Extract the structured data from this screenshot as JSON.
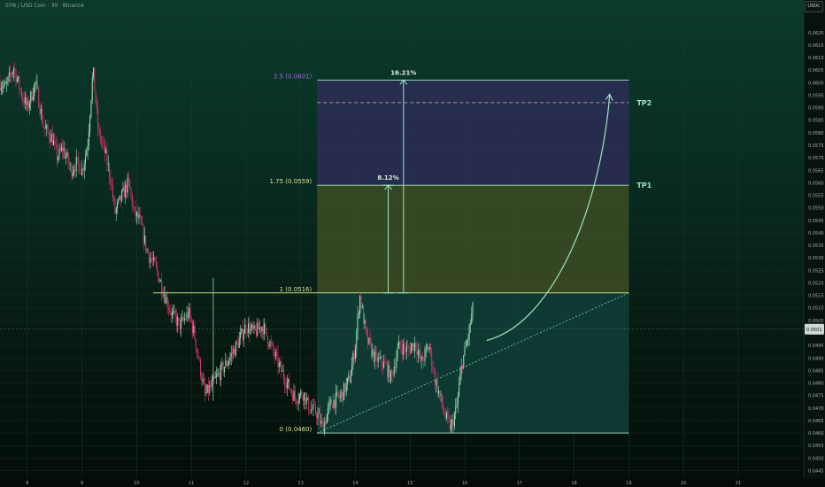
{
  "header": {
    "title": "SYN / USD Coin · 30 · Binance",
    "currency": "USDC"
  },
  "colors": {
    "up": "#9fe6b8",
    "down": "#d6336c",
    "level_line": "#9fe6c2",
    "zone_top": "#2a2c52",
    "zone_mid": "#3a4a23",
    "zone_bottom": "#0f3d36",
    "tp_label": "#9fe6c2",
    "price_tag": "#cfd8d3"
  },
  "chart_data": {
    "type": "candlestick",
    "symbol": "SYN / USD Coin",
    "interval": "30",
    "exchange": "Binance",
    "x_axis": {
      "unit": "day",
      "range": [
        7.5,
        22.2
      ],
      "ticks": [
        "8",
        "9",
        "10",
        "11",
        "12",
        "13",
        "14",
        "15",
        "16",
        "17",
        "18",
        "19",
        "20",
        "21"
      ]
    },
    "y_axis": {
      "range": [
        0.0442,
        0.0633
      ],
      "ticks": [
        "0.0445",
        "0.0450",
        "0.0455",
        "0.0460",
        "0.0465",
        "0.0470",
        "0.0475",
        "0.0480",
        "0.0485",
        "0.0490",
        "0.0495",
        "0.0500",
        "0.0505",
        "0.0510",
        "0.0515",
        "0.0520",
        "0.0525",
        "0.0530",
        "0.0535",
        "0.0540",
        "0.0545",
        "0.0550",
        "0.0555",
        "0.0560",
        "0.0565",
        "0.0570",
        "0.0575",
        "0.0580",
        "0.0585",
        "0.0590",
        "0.0595",
        "0.0600",
        "0.0605",
        "0.0610",
        "0.0615",
        "0.0620"
      ]
    },
    "current_price": {
      "label": "0.0501",
      "value": 0.05015
    },
    "price_path": [
      [
        7.5,
        0.06
      ],
      [
        7.6,
        0.0598
      ],
      [
        7.75,
        0.0606
      ],
      [
        7.9,
        0.0595
      ],
      [
        8.0,
        0.059
      ],
      [
        8.15,
        0.06
      ],
      [
        8.3,
        0.0582
      ],
      [
        8.45,
        0.0578
      ],
      [
        8.55,
        0.057
      ],
      [
        8.65,
        0.0574
      ],
      [
        8.8,
        0.0565
      ],
      [
        8.9,
        0.0568
      ],
      [
        9.0,
        0.0565
      ],
      [
        9.1,
        0.0575
      ],
      [
        9.2,
        0.0605
      ],
      [
        9.3,
        0.058
      ],
      [
        9.42,
        0.0572
      ],
      [
        9.52,
        0.0562
      ],
      [
        9.6,
        0.0548
      ],
      [
        9.72,
        0.0554
      ],
      [
        9.85,
        0.056
      ],
      [
        9.95,
        0.0548
      ],
      [
        10.05,
        0.0545
      ],
      [
        10.2,
        0.0532
      ],
      [
        10.35,
        0.0526
      ],
      [
        10.5,
        0.0516
      ],
      [
        10.65,
        0.0507
      ],
      [
        10.8,
        0.0503
      ],
      [
        10.95,
        0.0508
      ],
      [
        11.05,
        0.05
      ],
      [
        11.15,
        0.0487
      ],
      [
        11.25,
        0.0475
      ],
      [
        11.4,
        0.048
      ],
      [
        11.55,
        0.0485
      ],
      [
        11.7,
        0.049
      ],
      [
        11.85,
        0.0496
      ],
      [
        12.0,
        0.0503
      ],
      [
        12.15,
        0.05
      ],
      [
        12.3,
        0.0503
      ],
      [
        12.45,
        0.0495
      ],
      [
        12.6,
        0.0487
      ],
      [
        12.75,
        0.048
      ],
      [
        12.9,
        0.0474
      ],
      [
        13.05,
        0.0476
      ],
      [
        13.15,
        0.047
      ],
      [
        13.3,
        0.0468
      ],
      [
        13.4,
        0.0462
      ],
      [
        13.55,
        0.0472
      ],
      [
        13.75,
        0.0475
      ],
      [
        13.9,
        0.0482
      ],
      [
        14.0,
        0.0495
      ],
      [
        14.08,
        0.0515
      ],
      [
        14.2,
        0.0498
      ],
      [
        14.35,
        0.049
      ],
      [
        14.55,
        0.0487
      ],
      [
        14.65,
        0.0482
      ],
      [
        14.8,
        0.0495
      ],
      [
        14.95,
        0.0493
      ],
      [
        15.1,
        0.0496
      ],
      [
        15.2,
        0.0488
      ],
      [
        15.35,
        0.0495
      ],
      [
        15.45,
        0.0482
      ],
      [
        15.55,
        0.0474
      ],
      [
        15.65,
        0.0466
      ],
      [
        15.75,
        0.0462
      ],
      [
        15.85,
        0.047
      ],
      [
        15.95,
        0.0488
      ],
      [
        16.05,
        0.0497
      ],
      [
        16.15,
        0.051
      ]
    ],
    "levels": [
      {
        "label": "2.5 (0.0601)",
        "value": 0.0601
      },
      {
        "label": "1.75 (0.0559)",
        "value": 0.0559
      },
      {
        "label": "1 (0.0516)",
        "value": 0.0516
      },
      {
        "label": "0 (0.0460)",
        "value": 0.046
      }
    ],
    "targets": [
      {
        "label": "TP1",
        "value": 0.0559
      },
      {
        "label": "TP2",
        "value": 0.0592
      }
    ],
    "measurements": [
      {
        "label": "8.12%",
        "from": 0.0516,
        "to": 0.0559,
        "x": 14.6
      },
      {
        "label": "16.21%",
        "from": 0.0516,
        "to": 0.0601,
        "x": 14.88
      }
    ],
    "zone": {
      "x_start": 13.3,
      "x_end": 19.0
    },
    "level_line_start_x": 10.3,
    "trendline": {
      "from": [
        13.3,
        0.046
      ],
      "to": [
        19.0,
        0.0516
      ]
    },
    "projection": {
      "from": [
        16.4,
        0.0497
      ],
      "to": [
        18.65,
        0.0595
      ]
    },
    "spike": {
      "x": 11.4,
      "high": 0.0522,
      "low": 0.0473
    }
  }
}
